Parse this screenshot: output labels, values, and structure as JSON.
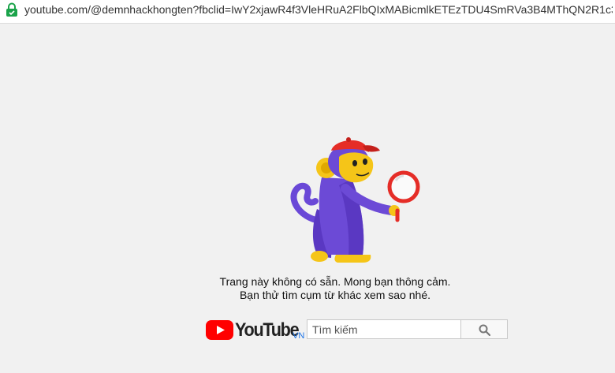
{
  "browser": {
    "url": "youtube.com/@demnhackhongten?fbclid=IwY2xjawR4f3VleHRuA2FlbQIxMABicmlkETEzTDU4SmRVa3B4MThQN2R1c3J0YwZhc..."
  },
  "error_page": {
    "line1": "Trang này không có sẵn. Mong bạn thông cảm.",
    "line2": "Bạn thử tìm cụm từ khác xem sao nhé."
  },
  "logo": {
    "wordmark": "YouTube",
    "country": "VN"
  },
  "search": {
    "placeholder": "Tìm kiếm",
    "value": ""
  },
  "colors": {
    "brand_red": "#ff0000",
    "monkey_purple": "#6c4ad6",
    "monkey_face": "#f5c518",
    "background": "#f1f1f1"
  },
  "icons": {
    "lock": "lock-icon",
    "search": "search-icon",
    "play": "youtube-play-icon",
    "illustration": "monkey-magnifier-illustration"
  }
}
